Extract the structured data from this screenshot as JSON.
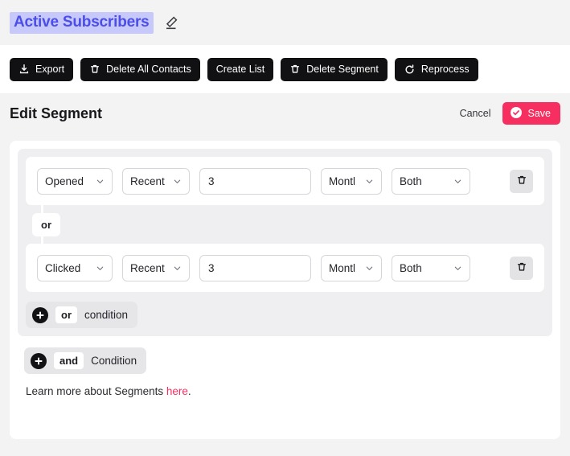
{
  "header": {
    "segment_name": "Active Subscribers",
    "edit_icon": "pencil-icon"
  },
  "toolbar": {
    "buttons": [
      {
        "label": "Export",
        "icon": "download-icon"
      },
      {
        "label": "Delete All Contacts",
        "icon": "trash-icon"
      },
      {
        "label": "Create List",
        "icon": "none"
      },
      {
        "label": "Delete Segment",
        "icon": "trash-icon"
      },
      {
        "label": "Reprocess",
        "icon": "refresh-icon"
      }
    ]
  },
  "page": {
    "title": "Edit Segment",
    "cancel_label": "Cancel",
    "save_label": "Save",
    "save_icon": "check-circle-icon",
    "save_color": "#f72e60"
  },
  "builder": {
    "conditions": [
      {
        "field": "Opened",
        "operator": "Recent",
        "value": "3",
        "unit": "Montl",
        "scope": "Both",
        "delete_icon": "trash-icon"
      },
      {
        "field": "Clicked",
        "operator": "Recent",
        "value": "3",
        "unit": "Montl",
        "scope": "Both",
        "delete_icon": "trash-icon"
      }
    ],
    "or_connector_label": "or",
    "add_or": {
      "plus_icon": "plus-circle-icon",
      "keyword": "or",
      "text": "condition"
    },
    "add_and": {
      "plus_icon": "plus-circle-icon",
      "keyword": "and",
      "text": "Condition"
    },
    "footer": {
      "text_before": "Learn more about Segments ",
      "link": "here",
      "text_after": ".",
      "link_color": "#f72e60"
    }
  }
}
